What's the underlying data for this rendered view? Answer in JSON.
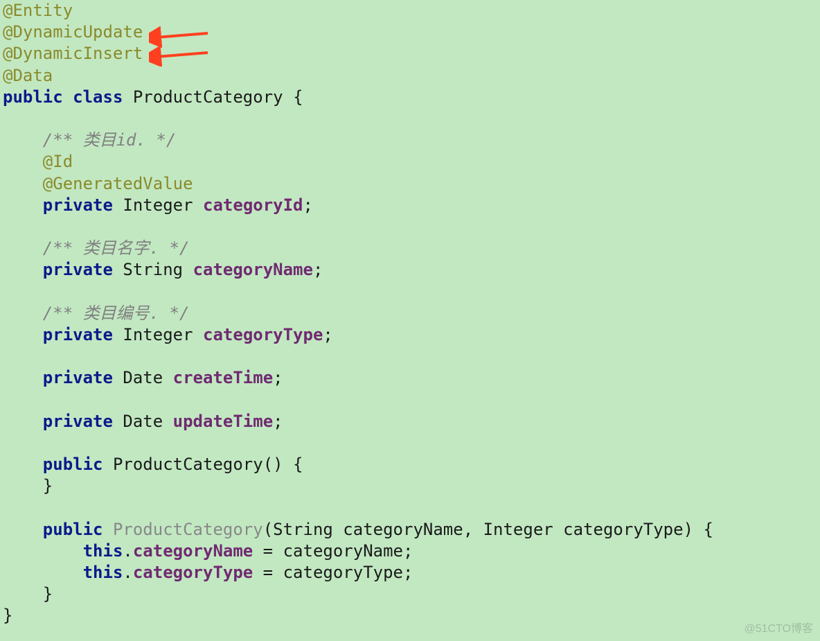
{
  "code": {
    "annEntity": "@Entity",
    "annDynUpdate": "@DynamicUpdate",
    "annDynInsert": "@DynamicInsert",
    "annData": "@Data",
    "kwPublic": "public",
    "kwClass": "class",
    "className": "ProductCategory",
    "openBrace": "{",
    "closeBrace": "}",
    "cmtId": "/** 类目id. */",
    "annId": "@Id",
    "annGen": "@GeneratedValue",
    "kwPrivate": "private",
    "typeInteger": "Integer",
    "typeString": "String",
    "typeDate": "Date",
    "fCategoryId": "categoryId",
    "fCategoryName": "categoryName",
    "fCategoryType": "categoryType",
    "fCreateTime": "createTime",
    "fUpdateTime": "updateTime",
    "semi": ";",
    "cmtName": "/** 类目名字. */",
    "cmtType": "/** 类目编号. */",
    "ctor0Sig": "ProductCategory()",
    "ctor1Name": "ProductCategory",
    "ctor1Params": "(String categoryName, Integer categoryType)",
    "kwThis": "this",
    "dot": ".",
    "eq": " = ",
    "assignName": "categoryName",
    "assignType": "categoryType"
  },
  "watermark": "@51CTO博客"
}
